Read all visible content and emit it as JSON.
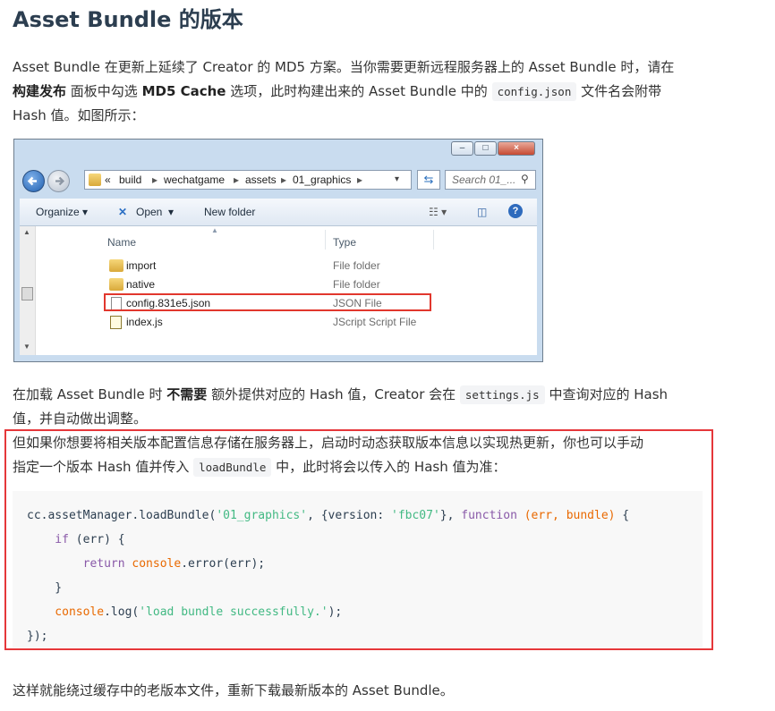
{
  "heading": "Asset Bundle 的版本",
  "para1": {
    "line1": "Asset Bundle 在更新上延续了 Creator 的 MD5 方案。当你需要更新远程服务器上的 Asset Bundle 时，请在",
    "bold_build": "构建发布",
    "mid1": " 面板中勾选 ",
    "bold_md5": "MD5 Cache",
    "mid2": " 选项，此时构建出来的 Asset Bundle 中的 ",
    "code": "config.json",
    "tail": " 文件名会附带",
    "line3": "Hash 值。如图所示："
  },
  "explorer": {
    "path": [
      "«",
      "build",
      "wechatgame",
      "assets",
      "01_graphics"
    ],
    "search_placeholder": "Search 01_...",
    "toolbar": {
      "organize": "Organize",
      "open": "Open",
      "new_folder": "New folder"
    },
    "columns": {
      "name": "Name",
      "type": "Type"
    },
    "files": [
      {
        "name": "import",
        "type": "File folder",
        "icon": "folder-icon"
      },
      {
        "name": "native",
        "type": "File folder",
        "icon": "folder-icon"
      },
      {
        "name": "config.831e5.json",
        "type": "JSON File",
        "icon": "file-icon"
      },
      {
        "name": "index.js",
        "type": "JScript Script File",
        "icon": "script-icon"
      }
    ],
    "highlight_color": "#e1372d"
  },
  "para2": {
    "pre": "在加载 Asset Bundle 时 ",
    "bold": "不需要",
    "mid": " 额外提供对应的 Hash 值，Creator 会在 ",
    "code": "settings.js",
    "post": " 中查询对应的 Hash",
    "line2": "值，并自动做出调整。"
  },
  "para3": {
    "line1": "但如果你想要将相关版本配置信息存储在服务器上，启动时动态获取版本信息以实现热更新，你也可以手动",
    "pre2": "指定一个版本 Hash 值并传入 ",
    "code": "loadBundle",
    "post2": " 中，此时将会以传入的 Hash 值为准："
  },
  "code_lines": {
    "l1a": "cc.assetManager.loadBundle(",
    "l1b": "'01_graphics'",
    "l1c": ", {version: ",
    "l1d": "'fbc07'",
    "l1e": "}, ",
    "l1f": "function",
    "l1g": " (err, bundle)",
    "l1h": " {",
    "l2a": "    if",
    "l2b": " (err) {",
    "l3a": "        return",
    "l3b": " console",
    "l3c": ".error(err);",
    "l4": "    }",
    "l5a": "    console",
    "l5b": ".log(",
    "l5c": "'load bundle successfully.'",
    "l5d": ");",
    "l6": "});"
  },
  "para4": "这样就能绕过缓存中的老版本文件，重新下载最新版本的 Asset Bundle。",
  "colors": {
    "red_border": "#e5373a",
    "string": "#42b983",
    "keyword": "#8959a8",
    "builtin": "#e96900"
  }
}
